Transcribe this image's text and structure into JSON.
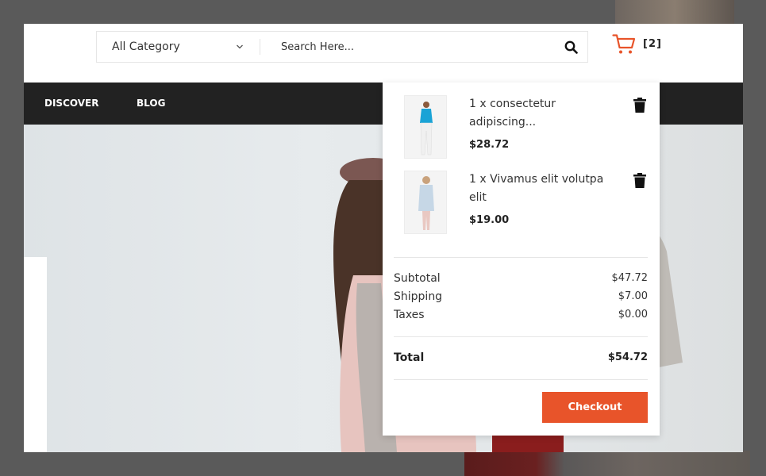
{
  "header": {
    "category_select": {
      "selected": "All Category"
    },
    "search": {
      "placeholder": "Search Here..."
    },
    "cart": {
      "count": "[2]"
    }
  },
  "nav": {
    "items": [
      {
        "label": "DISCOVER"
      },
      {
        "label": "BLOG"
      }
    ]
  },
  "cart_dropdown": {
    "items": [
      {
        "name": "1 x consectetur adipiscing...",
        "price": "$28.72"
      },
      {
        "name": "1 x Vivamus elit volutpa elit",
        "price": "$19.00"
      }
    ],
    "subtotal_label": "Subtotal",
    "subtotal_value": "$47.72",
    "shipping_label": "Shipping",
    "shipping_value": "$7.00",
    "taxes_label": "Taxes",
    "taxes_value": "$0.00",
    "total_label": "Total",
    "total_value": "$54.72",
    "checkout_label": "Checkout"
  },
  "colors": {
    "accent": "#e8542a",
    "nav_bg": "#222222",
    "overlay": "#5a5a5a"
  },
  "icons": {
    "chevron": "chevron-down-icon",
    "search": "search-icon",
    "cart": "cart-icon",
    "trash": "trash-icon"
  }
}
